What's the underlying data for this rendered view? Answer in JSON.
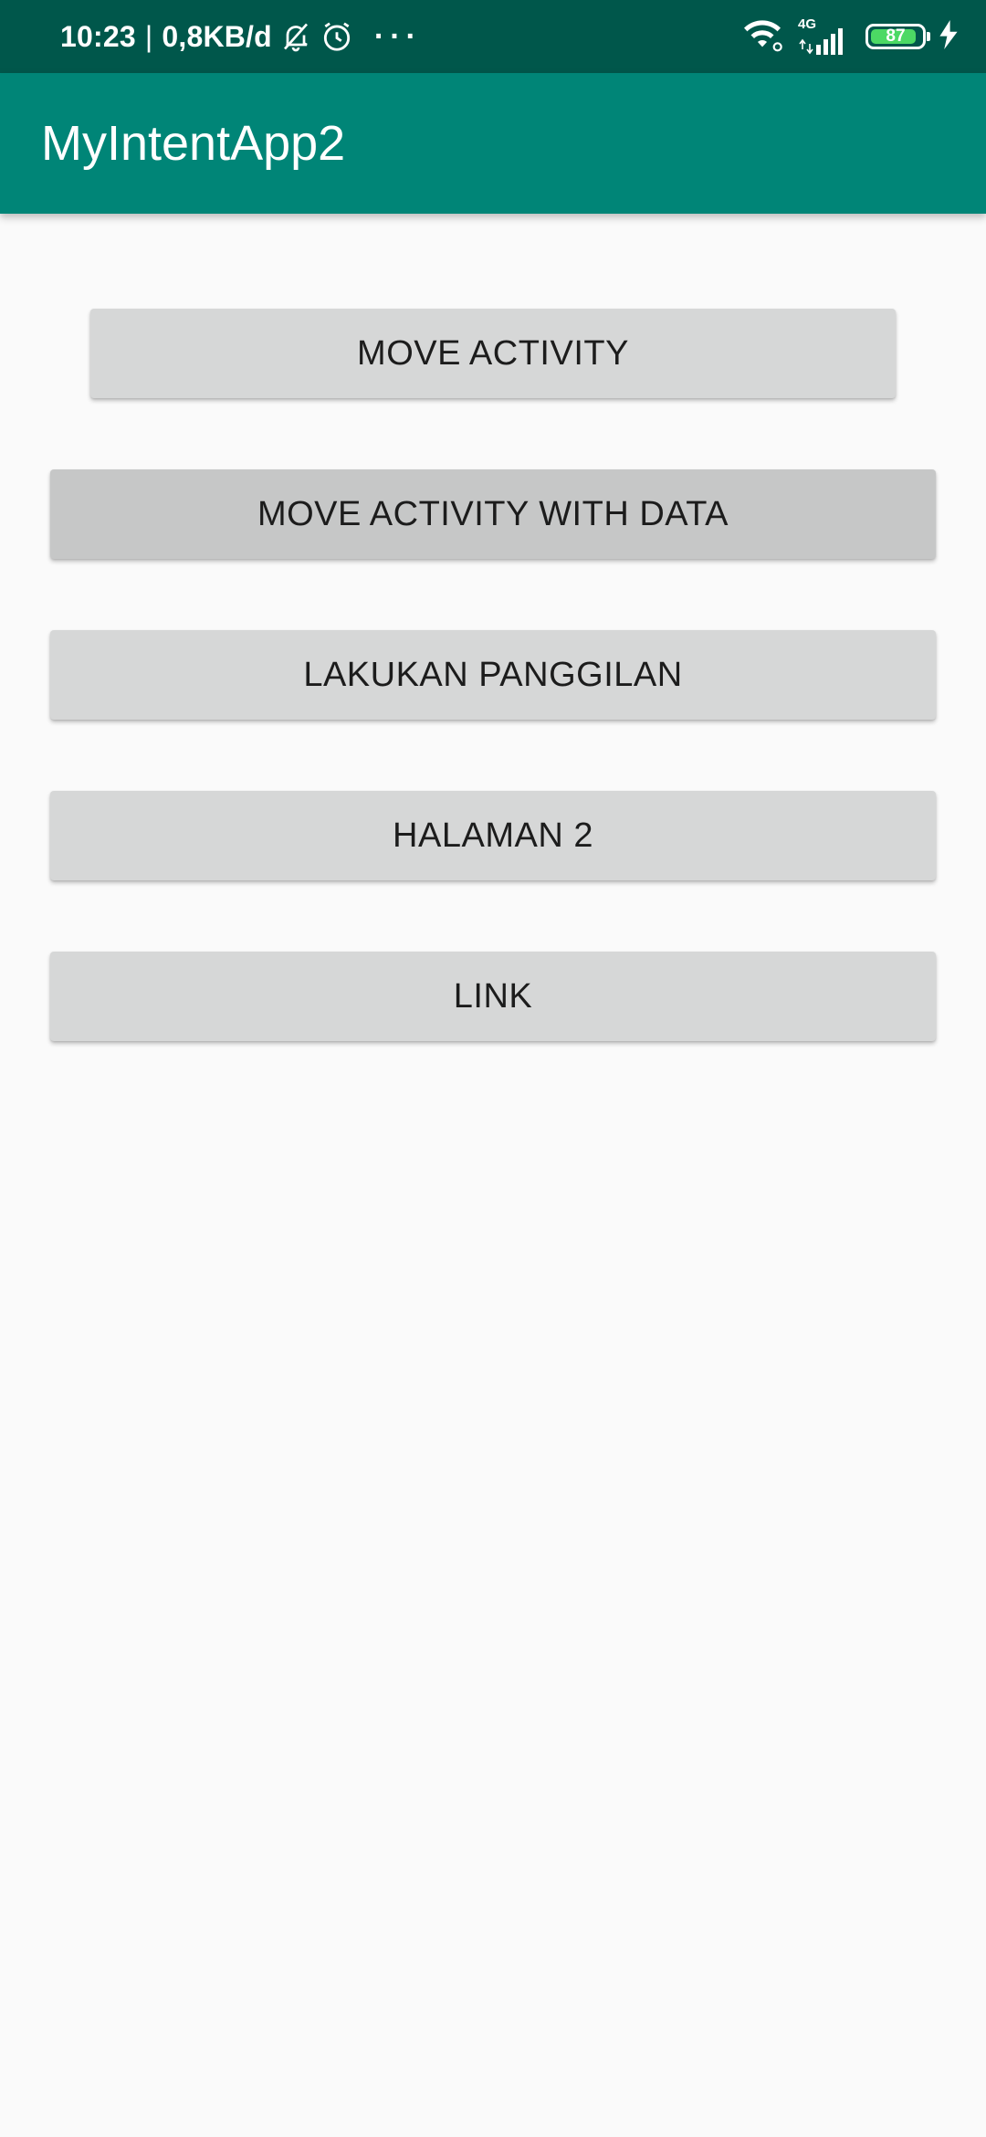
{
  "status_bar": {
    "time": "10:23",
    "net_speed": "0,8KB/d",
    "network_type": "4G",
    "battery": "87",
    "battery_level": 0.87,
    "icons": [
      "bell-muted-icon",
      "alarm-icon",
      "more-dots-icon",
      "wifi-icon",
      "signal-icon",
      "battery-icon",
      "charging-icon"
    ]
  },
  "app_bar": {
    "title": "MyIntentApp2",
    "color": "#008577",
    "status_color": "#00574b"
  },
  "buttons": [
    {
      "label": "MOVE ACTIVITY"
    },
    {
      "label": "MOVE ACTIVITY WITH DATA"
    },
    {
      "label": "LAKUKAN PANGGILAN"
    },
    {
      "label": "HALAMAN 2"
    },
    {
      "label": "LINK"
    }
  ]
}
